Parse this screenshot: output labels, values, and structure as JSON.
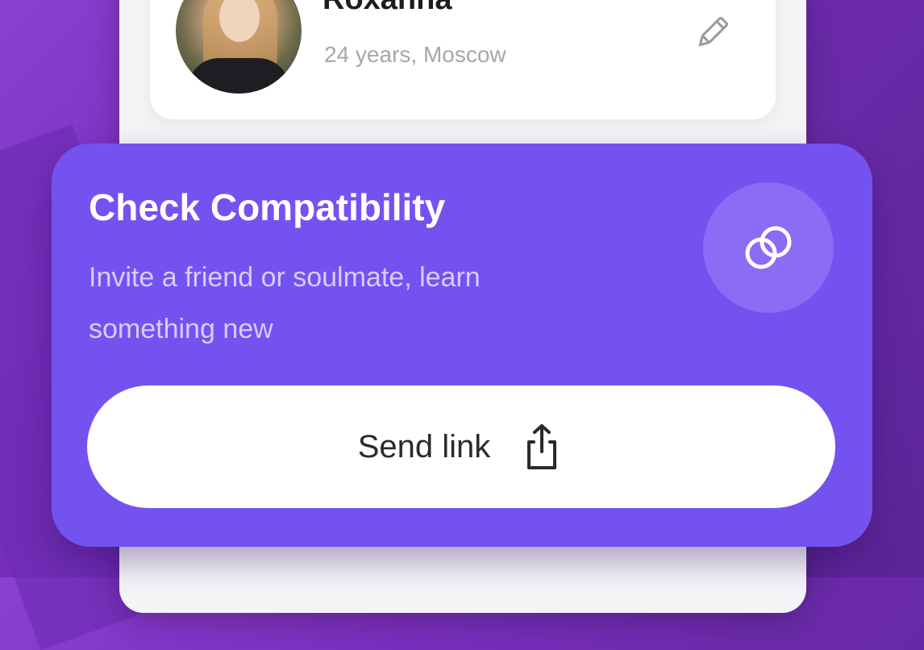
{
  "profile": {
    "name": "Roxanna",
    "subtitle": "24 years, Moscow"
  },
  "promo": {
    "title": "Check Compatibility",
    "description": "Invite a friend or soulmate, learn something new",
    "button_label": "Send link"
  },
  "icons": {
    "edit": "pencil-icon",
    "rings": "linked-rings-icon",
    "share": "share-icon"
  },
  "colors": {
    "background": "#7a2fc0",
    "promo_card": "#7452f0",
    "accent_text": "#d6ccff",
    "button_bg": "#ffffff"
  }
}
